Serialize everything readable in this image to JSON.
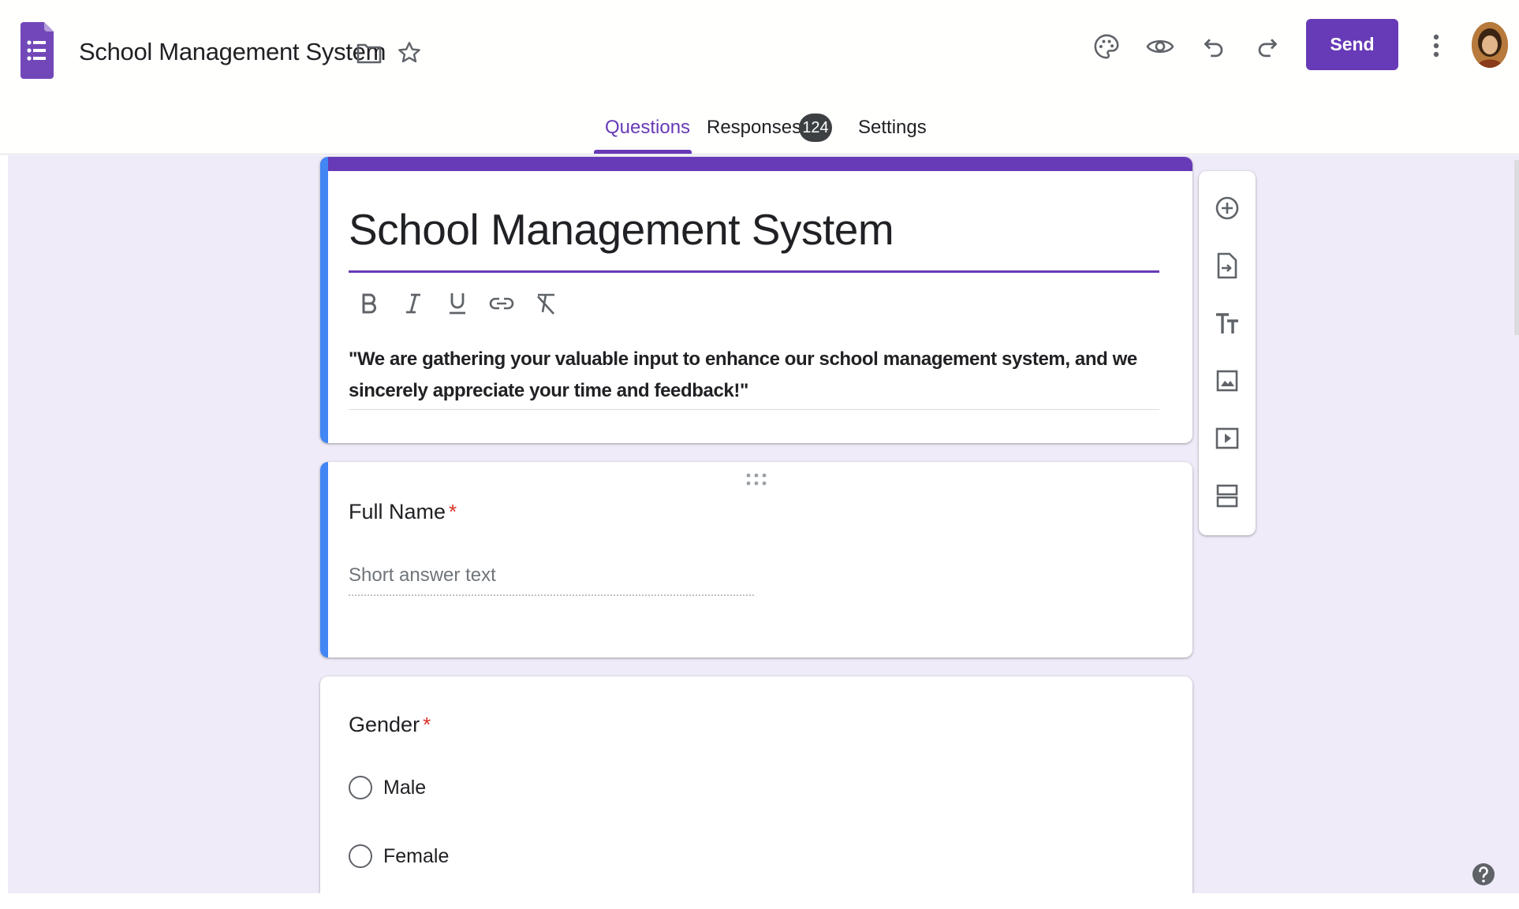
{
  "app": {
    "doc_title": "School Management System",
    "send_label": "Send",
    "accent_color": "#673ab7"
  },
  "tabs": [
    {
      "label": "Questions",
      "active": true
    },
    {
      "label": "Responses",
      "badge": "124"
    },
    {
      "label": "Settings"
    }
  ],
  "header_icons": [
    "forms-logo-icon",
    "folder-icon",
    "star-icon",
    "palette-icon",
    "preview-eye-icon",
    "undo-icon",
    "redo-icon",
    "more-vert-icon"
  ],
  "form": {
    "title": "School Management System",
    "description": "\"We are gathering your valuable input to enhance our school management system, and we sincerely appreciate your time and feedback!\"",
    "format_tools": [
      "bold-icon",
      "italic-icon",
      "underline-icon",
      "link-icon",
      "clear-format-icon"
    ]
  },
  "questions": [
    {
      "label": "Full Name",
      "required": "*",
      "type": "short",
      "placeholder": "Short answer text"
    },
    {
      "label": "Gender",
      "required": "*",
      "type": "radio",
      "options": [
        "Male",
        "Female"
      ]
    }
  ],
  "side_toolbar": [
    "add-question-icon",
    "import-questions-icon",
    "add-title-icon",
    "add-image-icon",
    "add-video-icon",
    "add-section-icon"
  ]
}
